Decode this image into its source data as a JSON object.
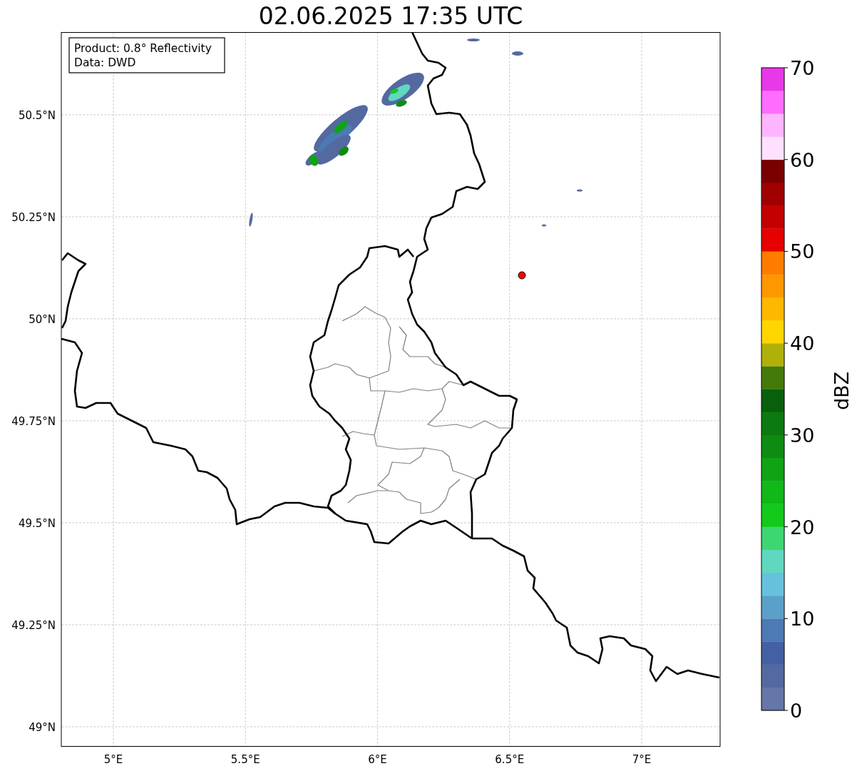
{
  "title": "02.06.2025 17:35 UTC",
  "info_box": {
    "lines": [
      "Product: 0.8° Reflectivity",
      "Data: DWD"
    ]
  },
  "x_ticks": [
    "5°E",
    "5.5°E",
    "6°E",
    "6.5°E",
    "7°E"
  ],
  "y_ticks": [
    "50.5°N",
    "50.25°N",
    "50°N",
    "49.75°N",
    "49.5°N",
    "49.25°N",
    "49°N"
  ],
  "colorbar": {
    "label": "dBZ",
    "ticks": [
      "70",
      "60",
      "50",
      "40",
      "30",
      "20",
      "10",
      "0"
    ],
    "colors": [
      {
        "color": "#6676a8"
      },
      {
        "color": "#5469a0"
      },
      {
        "color": "#4460a2"
      },
      {
        "color": "#4b7ab4"
      },
      {
        "color": "#5ba0c8"
      },
      {
        "color": "#66c2dc"
      },
      {
        "color": "#60d8c0"
      },
      {
        "color": "#3ed672"
      },
      {
        "color": "#12c91c"
      },
      {
        "color": "#10b818"
      },
      {
        "color": "#10a414"
      },
      {
        "color": "#0e8c12"
      },
      {
        "color": "#0c7a10"
      },
      {
        "color": "#08600c"
      },
      {
        "color": "#447a0a"
      },
      {
        "color": "#b0b008"
      },
      {
        "color": "#ffd600"
      },
      {
        "color": "#ffb800"
      },
      {
        "color": "#ff9800"
      },
      {
        "color": "#ff7c00"
      },
      {
        "color": "#e60000"
      },
      {
        "color": "#c40000"
      },
      {
        "color": "#a00000"
      },
      {
        "color": "#7a0000"
      },
      {
        "color": "#ffe0ff"
      },
      {
        "color": "#ffb4ff"
      },
      {
        "color": "#ff6cff"
      },
      {
        "color": "#e838e8"
      }
    ]
  }
}
